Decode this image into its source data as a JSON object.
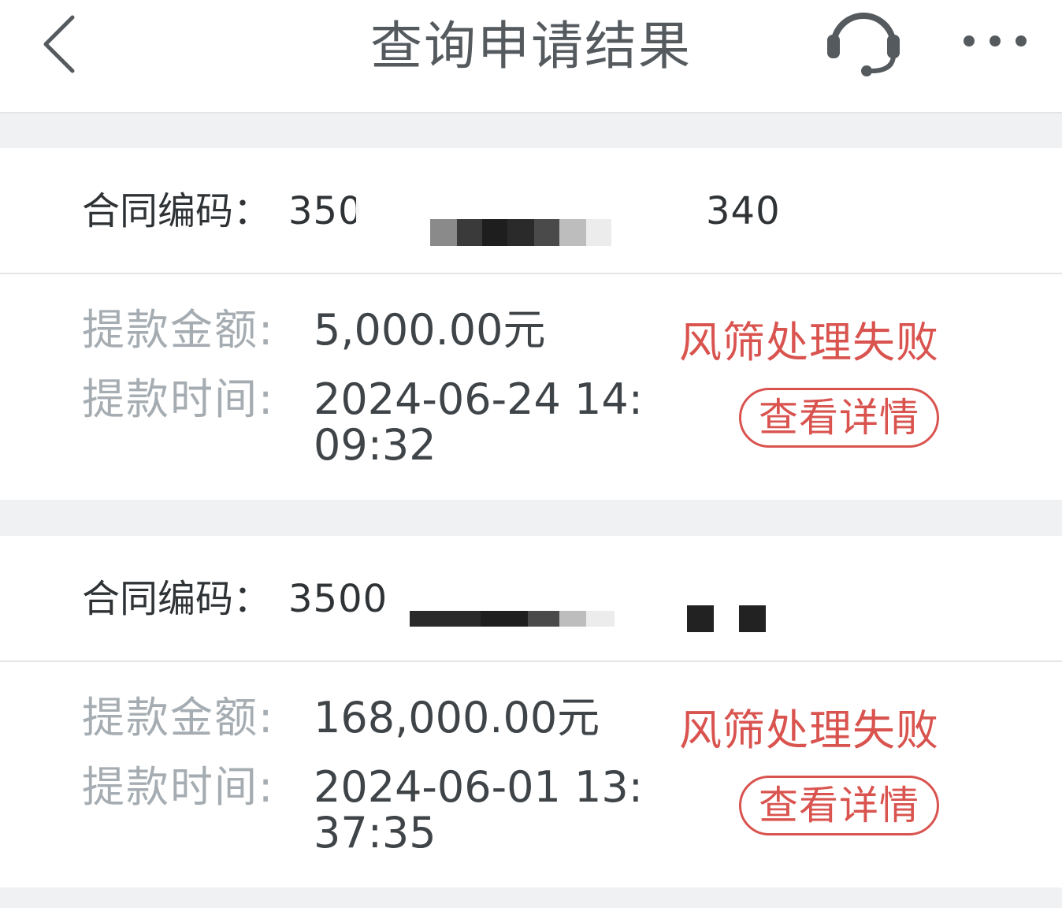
{
  "header": {
    "title": "查询申请结果",
    "back_icon": "chevron-left-icon",
    "service_icon": "headset-icon",
    "more_icon": "more-dots-icon"
  },
  "records": [
    {
      "contract_label": "合同编码：",
      "contract_prefix": "350",
      "contract_suffix": "340",
      "amount_label": "提款金额:",
      "amount_value": "5,000.00元",
      "time_label": "提款时间:",
      "time_value": "2024-06-24 14:09:32",
      "status": "风筛处理失败",
      "detail_label": "查看详情"
    },
    {
      "contract_label": "合同编码：",
      "contract_prefix": "3500",
      "contract_suffix": "",
      "amount_label": "提款金额:",
      "amount_value": "168,000.00元",
      "time_label": "提款时间:",
      "time_value": "2024-06-01 13:37:35",
      "status": "风筛处理失败",
      "detail_label": "查看详情"
    }
  ],
  "colors": {
    "status_red": "#d9534f",
    "label_gray": "#a6adb2",
    "text_dark": "#2f3336",
    "page_bg": "#f0f1f3"
  }
}
